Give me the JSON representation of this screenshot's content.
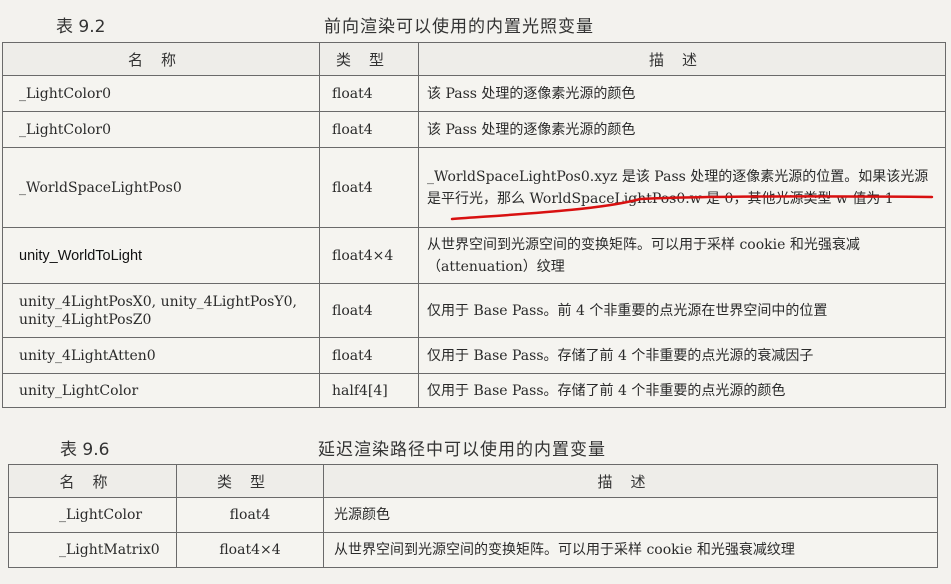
{
  "table1": {
    "number": "表 9.2",
    "title": "前向渲染可以使用的内置光照变量",
    "headers": [
      "名称",
      "类型",
      "描述"
    ],
    "rows": [
      {
        "name": "_LightColor0",
        "type": "float4",
        "desc": "该 Pass 处理的逐像素光源的颜色"
      },
      {
        "name": "_LightColor0",
        "type": "float4",
        "desc": "该 Pass 处理的逐像素光源的颜色"
      },
      {
        "name": "_WorldSpaceLightPos0",
        "type": "float4",
        "desc": "_WorldSpaceLightPos0.xyz 是该 Pass 处理的逐像素光源的位置。如果该光源是平行光，那么 WorldSpaceLightPos0.w 是 0，其他光源类型 w 值为 1"
      },
      {
        "name": "unity_WorldToLight",
        "type": "float4×4",
        "desc": "从世界空间到光源空间的变换矩阵。可以用于采样 cookie 和光强衰减（attenuation）纹理"
      },
      {
        "name": "unity_4LightPosX0, unity_4LightPosY0, unity_4LightPosZ0",
        "type": "float4",
        "desc": "仅用于 Base Pass。前 4 个非重要的点光源在世界空间中的位置"
      },
      {
        "name": "unity_4LightAtten0",
        "type": "float4",
        "desc": "仅用于 Base Pass。存储了前 4 个非重要的点光源的衰减因子"
      },
      {
        "name": "unity_LightColor",
        "type": "half4[4]",
        "desc": "仅用于 Base Pass。存储了前 4 个非重要的点光源的颜色"
      }
    ]
  },
  "table2": {
    "number": "表 9.6",
    "title": "延迟渲染路径中可以使用的内置变量",
    "headers": [
      "名称",
      "类型",
      "描述"
    ],
    "rows": [
      {
        "name": "_LightColor",
        "type": "float4",
        "desc": "光源颜色"
      },
      {
        "name": "_LightMatrix0",
        "type": "float4×4",
        "desc": "从世界空间到光源空间的变换矩阵。可以用于采样 cookie 和光强衰减纹理"
      }
    ]
  },
  "annotation_color": "#d81010"
}
